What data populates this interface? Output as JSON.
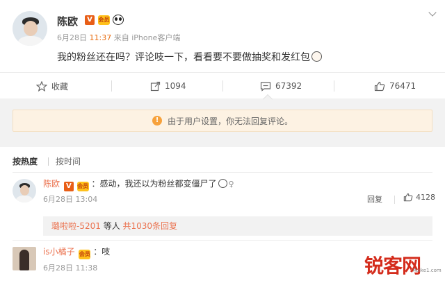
{
  "post": {
    "author": "陈欧",
    "date": "6月28日",
    "time": "11:37",
    "source": "来自 iPhone客户端",
    "text": "我的粉丝还在吗？评论吱一下，看看要不要做抽奖和发红包",
    "vip_badge": "V",
    "crown_badge": "会员"
  },
  "actions": {
    "favorite": "收藏",
    "repost": "1094",
    "comment": "67392",
    "like": "76471"
  },
  "notice": {
    "text": "由于用户设置，你无法回复评论。",
    "icon": "warning-icon"
  },
  "comments": {
    "sort_hot": "按热度",
    "sort_time": "按时间",
    "items": [
      {
        "user": "陈欧",
        "text": "：感动，我还以为粉丝都变僵尸了",
        "date": "6月28日 13:04",
        "reply_label": "回复",
        "likes": "4128",
        "subreply_user": "璐啦啦-5201",
        "subreply_mid": " 等人 ",
        "subreply_link": "共1030条回复"
      },
      {
        "user": "is小橘子",
        "text": "：吱",
        "date": "6月28日 11:38"
      }
    ]
  },
  "watermark": {
    "main": "锐客网",
    "sub": "Ruike1.com"
  },
  "colors": {
    "accent": "#eb7350",
    "brand_orange": "#e85e17",
    "notice_bg": "#fdf2e3"
  }
}
